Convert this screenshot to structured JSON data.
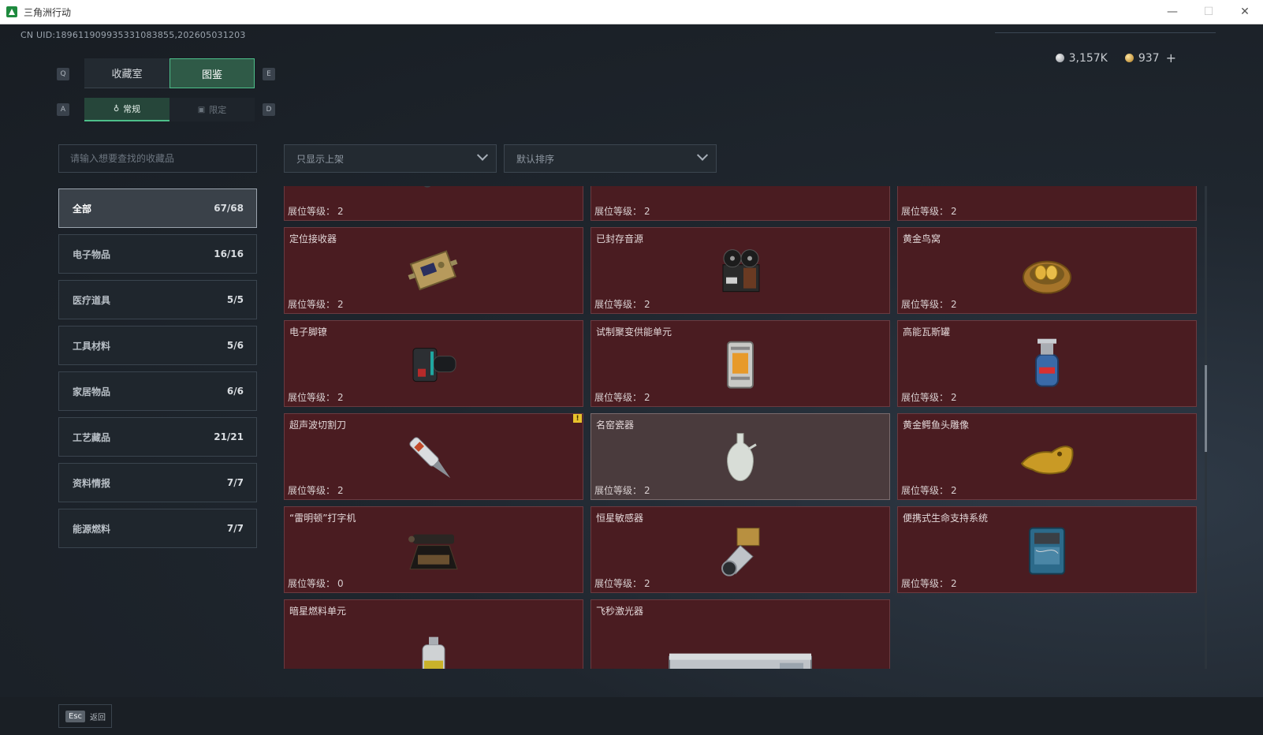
{
  "window": {
    "title": "三角洲行动",
    "minimize": "—",
    "maximize": "☐",
    "close": "✕"
  },
  "uid": "CN UID:18961190993533108385​5,202605031203",
  "currency": {
    "silver": "3,157K",
    "gold": "937",
    "plus": "+"
  },
  "keys": {
    "q": "Q",
    "e": "E",
    "a": "A",
    "d": "D"
  },
  "tabs": [
    {
      "label": "收藏室",
      "active": false
    },
    {
      "label": "图鉴",
      "active": true
    }
  ],
  "subtabs": [
    {
      "label": "常规",
      "icon": "♁",
      "active": true
    },
    {
      "label": "限定",
      "icon": "▣",
      "active": false
    }
  ],
  "search": {
    "placeholder": "请输入想要查找的收藏品"
  },
  "filters": {
    "show": "只显示上架",
    "sort": "默认排序"
  },
  "categories": [
    {
      "label": "全部",
      "count": "67/68",
      "active": true
    },
    {
      "label": "电子物品",
      "count": "16/16"
    },
    {
      "label": "医疗道具",
      "count": "5/5"
    },
    {
      "label": "工具材料",
      "count": "5/6"
    },
    {
      "label": "家居物品",
      "count": "6/6"
    },
    {
      "label": "工艺藏品",
      "count": "21/21"
    },
    {
      "label": "资料情报",
      "count": "7/7"
    },
    {
      "label": "能源燃料",
      "count": "7/7"
    }
  ],
  "level_label": "展位等级：",
  "items": [
    {
      "name": "",
      "level": "2",
      "icon": "flashlight-icon"
    },
    {
      "name": "",
      "level": "2",
      "icon": "painting-card-icon"
    },
    {
      "name": "",
      "level": "2",
      "icon": "gold-frame-icon"
    },
    {
      "name": "定位接收器",
      "level": "2",
      "icon": "receiver-icon"
    },
    {
      "name": "已封存音源",
      "level": "2",
      "icon": "reel-recorder-icon"
    },
    {
      "name": "黄金鸟窝",
      "level": "2",
      "icon": "golden-nest-icon"
    },
    {
      "name": "电子脚镣",
      "level": "2",
      "icon": "ankle-monitor-icon"
    },
    {
      "name": "试制聚变供能单元",
      "level": "2",
      "icon": "fusion-unit-icon"
    },
    {
      "name": "高能瓦斯罐",
      "level": "2",
      "icon": "gas-tank-icon"
    },
    {
      "name": "超声波切割刀",
      "level": "2",
      "icon": "ultrasonic-cutter-icon",
      "warn": "!"
    },
    {
      "name": "名窑瓷器",
      "level": "2",
      "icon": "porcelain-vase-icon",
      "highlight": true
    },
    {
      "name": "黄金鳄鱼头雕像",
      "level": "2",
      "icon": "gold-crocodile-icon"
    },
    {
      "name": "“雷明顿”打字机",
      "level": "0",
      "icon": "typewriter-icon"
    },
    {
      "name": "恒星敏感器",
      "level": "2",
      "icon": "star-sensor-icon"
    },
    {
      "name": "便携式生命支持系统",
      "level": "2",
      "icon": "life-support-icon"
    },
    {
      "name": "暗星燃料单元",
      "level": "",
      "icon": "fuel-canister-icon"
    },
    {
      "name": "飞秒激光器",
      "level": "",
      "icon": "laser-device-icon"
    }
  ],
  "footer": {
    "esc": "Esc",
    "back": "返回"
  }
}
